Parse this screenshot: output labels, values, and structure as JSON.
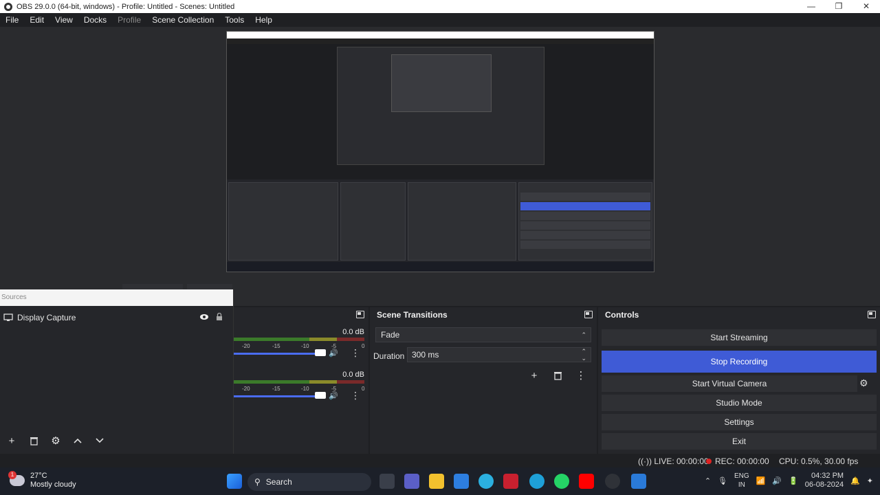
{
  "window": {
    "title": "OBS 29.0.0 (64-bit, windows) - Profile: Untitled - Scenes: Untitled",
    "controls": [
      "—",
      "❐",
      "✕"
    ]
  },
  "menu": [
    "File",
    "Edit",
    "View",
    "Docks",
    "Profile",
    "Scene Collection",
    "Tools",
    "Help"
  ],
  "sources": {
    "header": "Sources",
    "items": [
      {
        "label": "Display Capture"
      }
    ],
    "toolbar_icons": [
      "plus-icon",
      "trash-icon",
      "gear-icon",
      "arrow-up-icon",
      "arrow-down-icon"
    ]
  },
  "mixer": {
    "channels": [
      {
        "db": "0.0 dB"
      },
      {
        "db": "0.0 dB"
      }
    ],
    "ticks": [
      "-20",
      "-15",
      "-10",
      "-5",
      "0"
    ]
  },
  "scene_transitions": {
    "title": "Scene Transitions",
    "transition": "Fade",
    "duration_label": "Duration",
    "duration": "300 ms"
  },
  "controls": {
    "title": "Controls",
    "buttons": {
      "start_streaming": "Start Streaming",
      "stop_recording": "Stop Recording",
      "start_virtual_camera": "Start Virtual Camera",
      "studio_mode": "Studio Mode",
      "settings": "Settings",
      "exit": "Exit"
    }
  },
  "status": {
    "live": "LIVE: 00:00:00",
    "rec": "REC: 00:00:00",
    "cpu": "CPU: 0.5%, 30.00 fps"
  },
  "taskbar": {
    "weather_badge": "1",
    "temperature": "27°C",
    "weather_desc": "Mostly cloudy",
    "search_label": "Search",
    "lang_top": "ENG",
    "lang_bottom": "IN",
    "time": "04:32 PM",
    "date": "06-08-2024"
  },
  "colors": {
    "accent": "#3f5bd6",
    "panel": "#25262a",
    "rec": "#dd2222"
  }
}
